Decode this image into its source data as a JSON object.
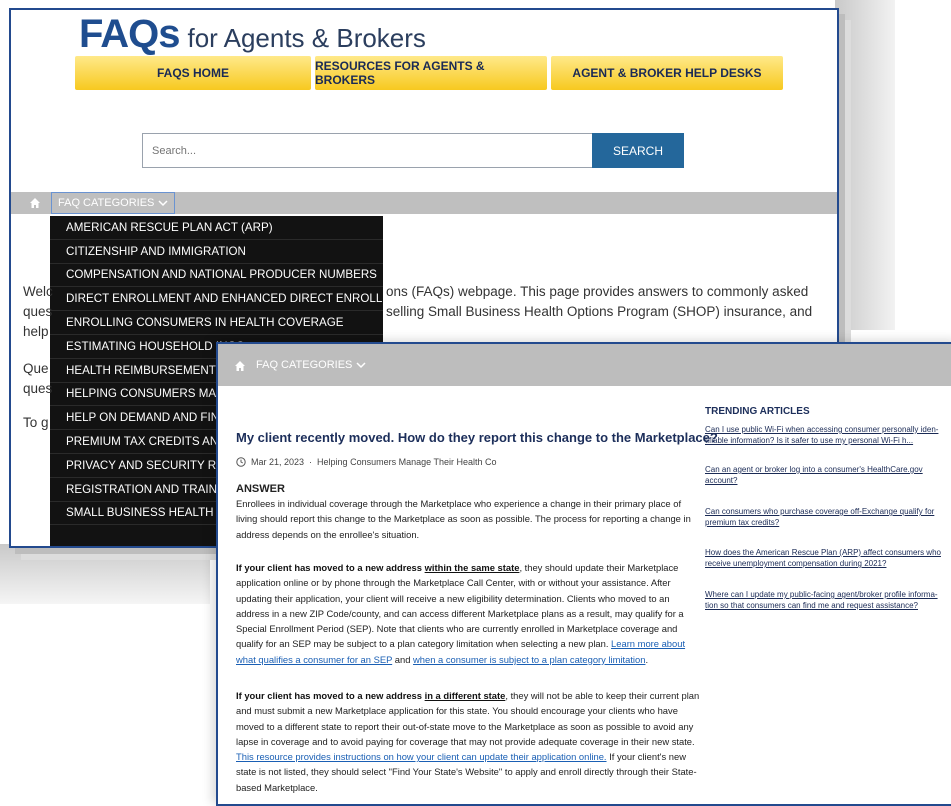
{
  "back_window": {
    "logo_faqs": "FAQs",
    "logo_sub": "for Agents & Brokers",
    "nav": [
      "FAQS HOME",
      "RESOURCES FOR AGENTS & BROKERS",
      "AGENT & BROKER HELP DESKS"
    ],
    "search_placeholder": "Search...",
    "search_button": "SEARCH",
    "categories_label": "FAQ CATEGORIES",
    "categories": [
      "AMERICAN RESCUE PLAN ACT (ARP)",
      "CITIZENSHIP AND IMMIGRATION",
      "COMPENSATION AND NATIONAL PRODUCER NUMBERS",
      "DIRECT ENROLLMENT AND ENHANCED DIRECT ENROLLMENT",
      "ENROLLING CONSUMERS IN HEALTH COVERAGE",
      "ESTIMATING HOUSEHOLD INCO",
      "HEALTH REIMBURSEMENT ARRA",
      "HELPING CONSUMERS MANAGE",
      "HELP ON DEMAND AND FIND LO",
      "PREMIUM TAX CREDITS AND FO",
      "PRIVACY AND SECURITY REQUIF",
      "REGISTRATION AND TRAINING R",
      "SMALL BUSINESS HEALTH OPTIC"
    ],
    "bg_fragments": {
      "welc": "Welc",
      "ques": "ques",
      "help": "help",
      "ques2": "Que",
      "ques3": "ques",
      "tog": "To g",
      "line1": "ons (FAQs) webpage. This page provides answers to commonly asked",
      "line2": "selling Small Business Health Options Program (SHOP) insurance, and"
    }
  },
  "front_window": {
    "categories_label": "FAQ CATEGORIES",
    "title": "My client recently moved. How do they report this change to the Marketplace?",
    "date": "Mar 21, 2023",
    "category": "Helping Consumers Manage Their Health Co",
    "answer_heading": "ANSWER",
    "p1": "Enrollees in individual coverage through the Marketplace who experience a change in their primary place of living should report this change to the Marketplace as soon as possible. The process for reporting a change in address depends on the enrollee's situation.",
    "p2_lead": "If your client has moved to a new address ",
    "p2_u": "within the same state",
    "p2_rest": ", they should update their Marketplace application online or by phone through the Marketplace Call Center, with or without your assistance. After updating their application, your client will receive a new eligibility determination. Clients who moved to an address in a new ZIP Code/county, and can access different Marketplace plans as a result, may qualify for a Special Enrollment Period (SEP). Note that clients who are currently enrolled in Marketplace coverage and qualify for an SEP may be subject to a plan category limitation when selecting a new plan. ",
    "p2_link1": "Learn more about what qualifies a consumer for an SEP",
    "p2_and": " and ",
    "p2_link2": "when a consumer is subject to a plan category limitation",
    "p2_end": ".",
    "p3_lead": "If your client has moved to a new address ",
    "p3_u": "in a different state",
    "p3_rest": ", they will not be able to keep their current plan and must submit a new Marketplace application for this state. You should encourage your clients who have moved to a different state to report their out-of-state move to the Marketplace as soon as possible to avoid any lapse in coverage and to avoid paying for coverage that may not provide adequate coverage in their new state. ",
    "p3_link": "This resource provides instructions on how your client can update their application online.",
    "p3_end": " If your client's new state is not listed, they should select \"Find Your State's Website\" to apply and enroll directly through their State-based Marketplace.",
    "trending_heading": "TRENDING ARTICLES",
    "trending": [
      "Can I use public Wi-Fi when accessing consumer personally iden-tifiable information? Is it safer to use my personal Wi-Fi h...",
      "Can an agent or broker log into a consumer's HealthCare.gov account?",
      "Can consumers who purchase coverage off-Exchange qualify for premium tax credits?",
      "How does the American Rescue Plan (ARP) affect consumers who receive unemployment compensation during 2021?",
      "Where can I update my public-facing agent/broker profile informa-tion so that consumers can find me and request assistance?"
    ]
  }
}
